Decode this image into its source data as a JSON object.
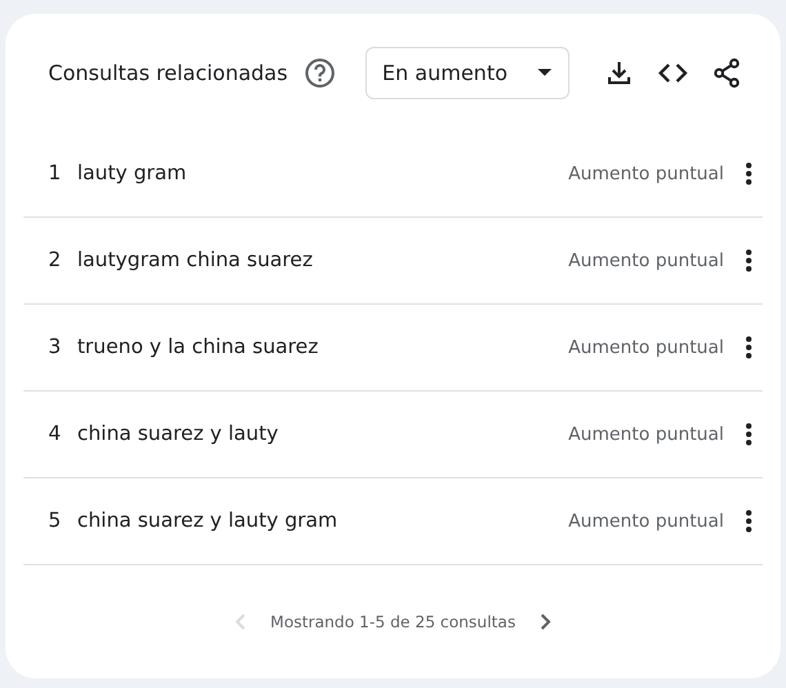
{
  "card": {
    "title": "Consultas relacionadas",
    "dropdown": {
      "value": "En aumento"
    },
    "rows": [
      {
        "rank": "1",
        "query": "lauty gram",
        "value": "Aumento puntual"
      },
      {
        "rank": "2",
        "query": "lautygram china suarez",
        "value": "Aumento puntual"
      },
      {
        "rank": "3",
        "query": "trueno y la china suarez",
        "value": "Aumento puntual"
      },
      {
        "rank": "4",
        "query": "china suarez y lauty",
        "value": "Aumento puntual"
      },
      {
        "rank": "5",
        "query": "china suarez y lauty gram",
        "value": "Aumento puntual"
      }
    ],
    "pagination": {
      "text": "Mostrando 1-5 de 25 consultas",
      "prev_disabled": true,
      "next_disabled": false
    }
  }
}
